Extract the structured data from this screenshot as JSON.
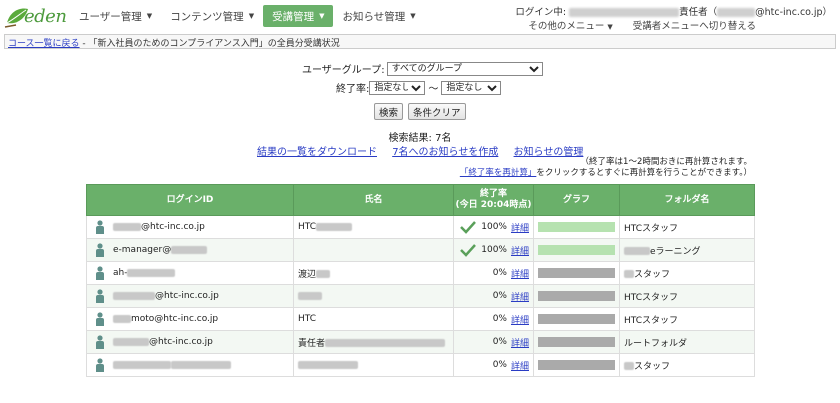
{
  "header": {
    "logo_text": "eden",
    "nav": [
      {
        "label": "ユーザー管理",
        "active": false
      },
      {
        "label": "コンテンツ管理",
        "active": false
      },
      {
        "label": "受講管理",
        "active": true
      },
      {
        "label": "お知らせ管理",
        "active": false
      }
    ],
    "login_prefix": "ログイン中:",
    "login_suffix": "責任者（",
    "login_email_domain": "@htc-inc.co.jp）",
    "other_menu": "その他のメニュー",
    "switch_menu": "受講者メニューへ切り替える"
  },
  "breadcrumb": {
    "link": "コース一覧に戻る",
    "separator": " - ",
    "current": "「新入社員のためのコンプライアンス入門」の全員分受講状況"
  },
  "filter": {
    "group_label": "ユーザーグループ:",
    "group_value": "すべてのグループ",
    "rate_label": "終了率:",
    "rate_from": "指定なし",
    "tilde": "〜",
    "rate_to": "指定なし",
    "search_button": "検索",
    "clear_button": "条件クリア"
  },
  "results": {
    "count_text": "検索結果: 7名",
    "link_download": "結果の一覧をダウンロード",
    "link_notice": "7名へのお知らせを作成",
    "link_manage": "お知らせの管理",
    "note_line1": "（終了率は1〜2時間おきに再計算されます。",
    "note_link": "「終了率を再計算」",
    "note_line2": "をクリックするとすぐに再計算を行うことができます。）"
  },
  "table": {
    "headers": {
      "login_id": "ログインID",
      "name": "氏名",
      "rate_line1": "終了率",
      "rate_line2": "(今日 20:04時点)",
      "graph": "グラフ",
      "folder": "フォルダ名"
    },
    "detail_label": "詳細",
    "rows": [
      {
        "id_suffix": "@htc-inc.co.jp",
        "name": "HTC",
        "rate": "100%",
        "rate_value": 100,
        "folder": "HTCスタッフ"
      },
      {
        "id_suffix": "e-manager@",
        "name": "",
        "rate": "100%",
        "rate_value": 100,
        "folder": "eラーニング"
      },
      {
        "id_suffix": "ah-",
        "name": "渡辺",
        "rate": "0%",
        "rate_value": 0,
        "folder": "スタッフ"
      },
      {
        "id_suffix": "@htc-inc.co.jp",
        "name": "",
        "rate": "0%",
        "rate_value": 0,
        "folder": "HTCスタッフ"
      },
      {
        "id_suffix": "moto@htc-inc.co.jp",
        "name": "HTC",
        "rate": "0%",
        "rate_value": 0,
        "folder": "HTCスタッフ"
      },
      {
        "id_suffix": "@htc-inc.co.jp",
        "name": "責任者",
        "rate": "0%",
        "rate_value": 0,
        "folder": "ルートフォルダ"
      },
      {
        "id_suffix": "",
        "name": "",
        "rate": "0%",
        "rate_value": 0,
        "folder": "スタッフ"
      }
    ]
  }
}
